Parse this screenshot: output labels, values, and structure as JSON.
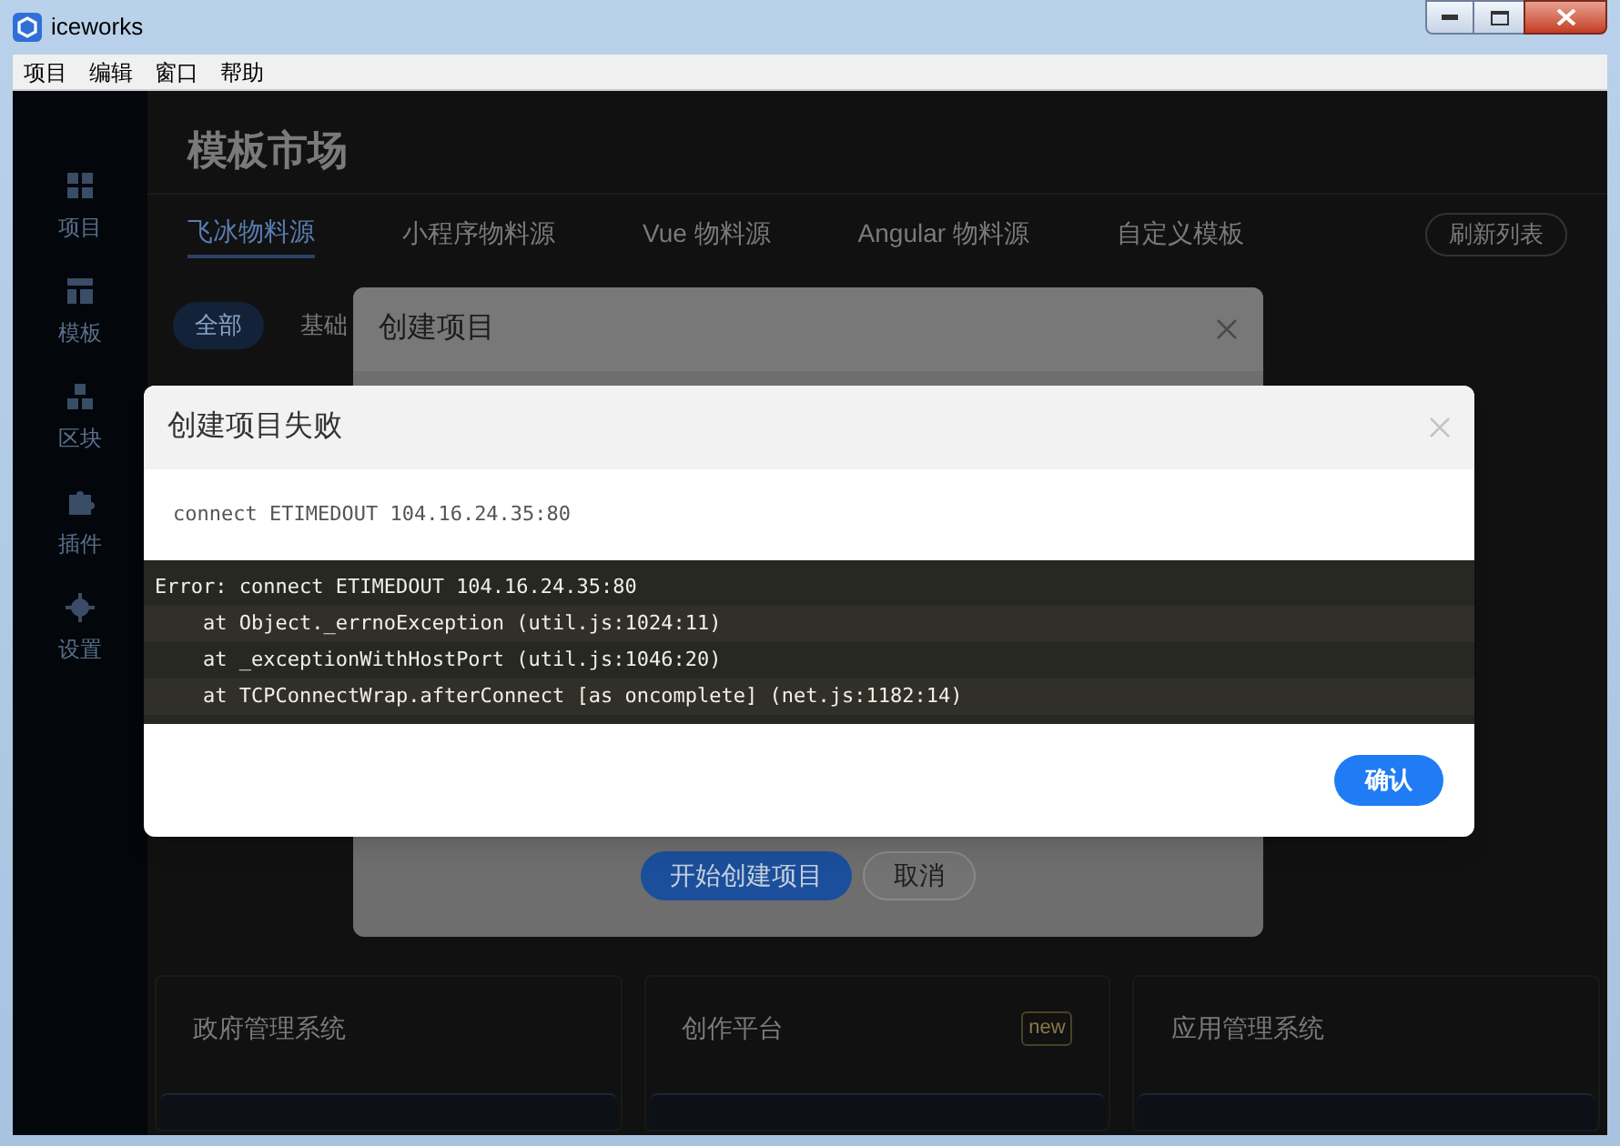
{
  "window": {
    "title": "iceworks"
  },
  "menu": [
    "项目",
    "编辑",
    "窗口",
    "帮助"
  ],
  "sidebar": [
    {
      "label": "项目"
    },
    {
      "label": "模板"
    },
    {
      "label": "区块"
    },
    {
      "label": "插件"
    },
    {
      "label": "设置"
    }
  ],
  "page": {
    "heading": "模板市场",
    "tabs": [
      {
        "label": "飞冰物料源",
        "selected": true
      },
      {
        "label": "小程序物料源",
        "selected": false
      },
      {
        "label": "Vue 物料源",
        "selected": false
      },
      {
        "label": "Angular 物料源",
        "selected": false
      },
      {
        "label": "自定义模板",
        "selected": false
      }
    ],
    "refresh_button": "刷新列表",
    "filters": [
      {
        "label": "全部",
        "selected": true
      },
      {
        "label": "基础",
        "selected": false
      }
    ],
    "cards": [
      {
        "title": "政府管理系统"
      },
      {
        "title": "创作平台",
        "badge": "new"
      },
      {
        "title": "应用管理系统"
      }
    ]
  },
  "create_dialog": {
    "title": "创建项目",
    "primary_button": "开始创建项目",
    "cancel_button": "取消"
  },
  "error_dialog": {
    "title": "创建项目失败",
    "message": "connect ETIMEDOUT 104.16.24.35:80",
    "stack": [
      "Error: connect ETIMEDOUT 104.16.24.35:80",
      "    at Object._errnoException (util.js:1024:11)",
      "    at _exceptionWithHostPort (util.js:1046:20)",
      "    at TCPConnectWrap.afterConnect [as oncomplete] (net.js:1182:14)"
    ],
    "confirm_button": "确认"
  }
}
